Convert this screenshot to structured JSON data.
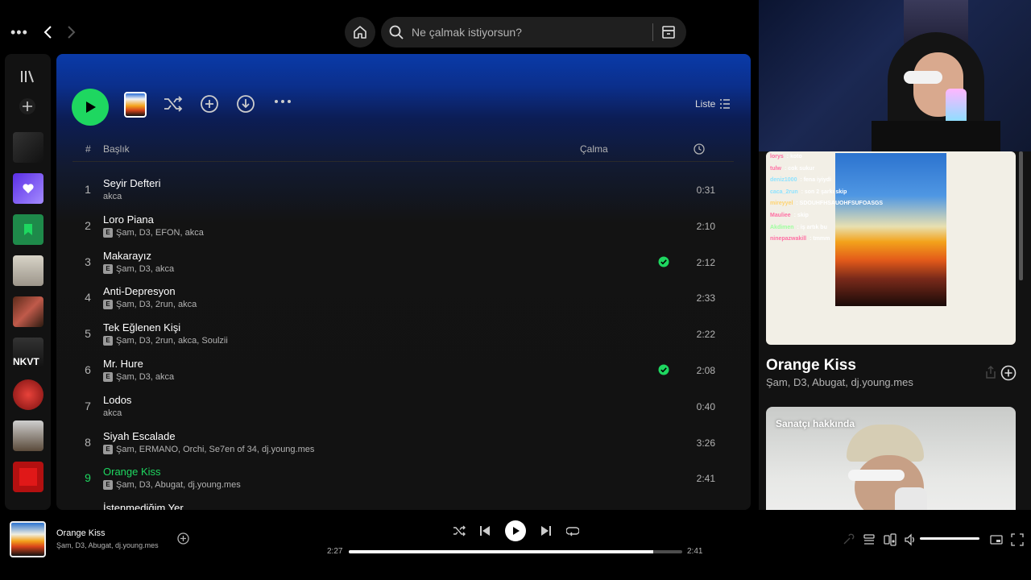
{
  "search": {
    "placeholder": "Ne çalmak istiyorsun?"
  },
  "sidebar": {
    "tiles": [
      {
        "label": "NKVT"
      }
    ]
  },
  "toolbar": {
    "view_label": "Liste"
  },
  "table": {
    "headers": {
      "num": "#",
      "title": "Başlık",
      "plays": "Çalma"
    },
    "rows": [
      {
        "num": "1",
        "title": "Seyir Defteri",
        "artists": "akca",
        "explicit": false,
        "saved": false,
        "duration": "0:31"
      },
      {
        "num": "2",
        "title": "Loro Piana",
        "artists": "Şam, D3, EFON, akca",
        "explicit": true,
        "saved": false,
        "duration": "2:10"
      },
      {
        "num": "3",
        "title": "Makarayız",
        "artists": "Şam, D3, akca",
        "explicit": true,
        "saved": true,
        "duration": "2:12"
      },
      {
        "num": "4",
        "title": "Anti-Depresyon",
        "artists": "Şam, D3, 2run, akca",
        "explicit": true,
        "saved": false,
        "duration": "2:33"
      },
      {
        "num": "5",
        "title": "Tek Eğlenen Kişi",
        "artists": "Şam, D3, 2run, akca, Soulzii",
        "explicit": true,
        "saved": false,
        "duration": "2:22"
      },
      {
        "num": "6",
        "title": "Mr. Hure",
        "artists": "Şam, D3, akca",
        "explicit": true,
        "saved": true,
        "duration": "2:08"
      },
      {
        "num": "7",
        "title": "Lodos",
        "artists": "akca",
        "explicit": false,
        "saved": false,
        "duration": "0:40"
      },
      {
        "num": "8",
        "title": "Siyah Escalade",
        "artists": "Şam, ERMANO, Orchi, Se7en of 34, dj.young.mes",
        "explicit": true,
        "saved": false,
        "duration": "3:26"
      },
      {
        "num": "9",
        "title": "Orange Kiss",
        "artists": "Şam, D3, Abugat, dj.young.mes",
        "explicit": true,
        "saved": false,
        "duration": "2:41",
        "active": true
      },
      {
        "num": "10",
        "title": "İstenmediğim Yer",
        "artists": "",
        "explicit": false,
        "saved": false,
        "duration": ""
      }
    ]
  },
  "now_playing_view": {
    "title": "Orange Kiss",
    "artists": "Şam, D3, Abugat, dj.young.mes",
    "about_title": "Sanatçı hakkında"
  },
  "chat": [
    {
      "user": "lorys",
      "msg": "koto",
      "color": "#ff6fa3"
    },
    {
      "user": "tulw",
      "msg": "cok sukur",
      "color": "#ff6fa3"
    },
    {
      "user": "deniz1000",
      "msg": "fena iyiydi",
      "color": "#8fe3ff"
    },
    {
      "user": "caca_2run",
      "msg": "son 2 şarkı skip",
      "color": "#8fe3ff"
    },
    {
      "user": "mireyyel",
      "msg": "SDOUHFHSAUOHFSUFOASGS",
      "color": "#ffd36f"
    },
    {
      "user": "Mauliee",
      "msg": "skip",
      "color": "#ff6fa3"
    },
    {
      "user": "Akdimen",
      "msg": "iş artık bu",
      "color": "#9dff9d"
    },
    {
      "user": "ninepazwakill",
      "msg": "tmmm",
      "color": "#ff6fa3"
    }
  ],
  "player": {
    "title": "Orange Kiss",
    "artists": "Şam, D3, Abugat, dj.young.mes",
    "elapsed": "2:27",
    "duration": "2:41",
    "progress": 0.913,
    "volume": 1.0
  },
  "colors": {
    "accent": "#1ed760",
    "surface": "#121212",
    "header_blue": "#0a3aa8"
  }
}
